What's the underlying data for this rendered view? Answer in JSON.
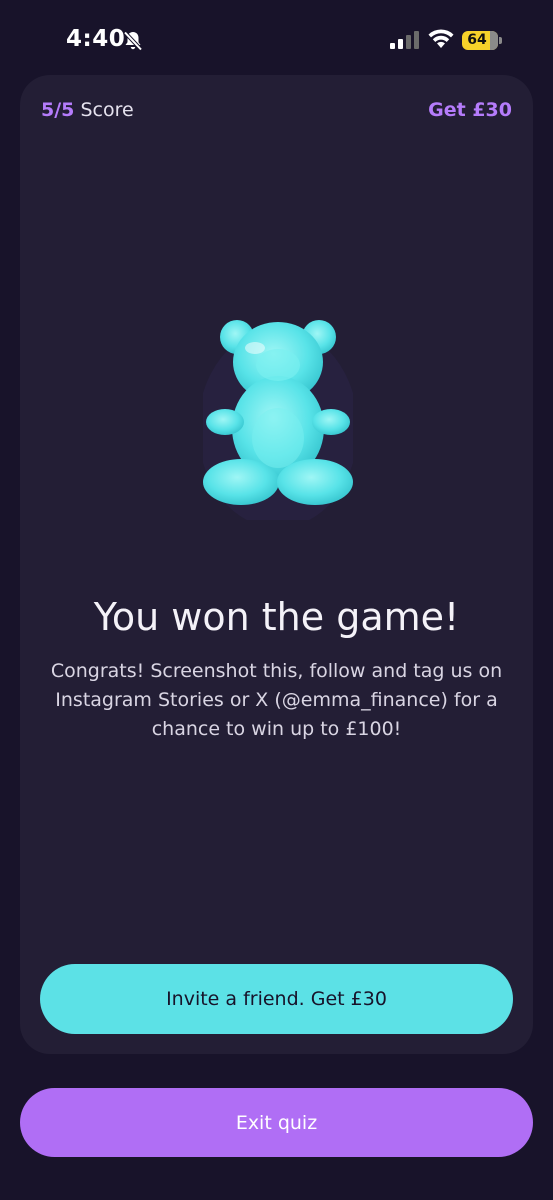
{
  "status_bar": {
    "time": "4:40",
    "battery": "64",
    "icons": [
      "bell-slash-icon",
      "signal-icon",
      "wifi-icon",
      "battery-icon"
    ]
  },
  "card": {
    "score_value": "5/5",
    "score_label": "Score",
    "reward_link": "Get £30",
    "image": "gummy-bear-icon",
    "headline": "You won the game!",
    "body": "Congrats! Screenshot this, follow and tag us on Instagram Stories or X (@emma_finance) for a chance to win up to £100!",
    "invite_button": "Invite a friend. Get £30"
  },
  "exit_button": "Exit quiz",
  "colors": {
    "background": "#18132a",
    "card": "#231e35",
    "purple_accent": "#b57cfb",
    "cyan_button": "#5ce1e6",
    "purple_button": "#b06ef5"
  }
}
